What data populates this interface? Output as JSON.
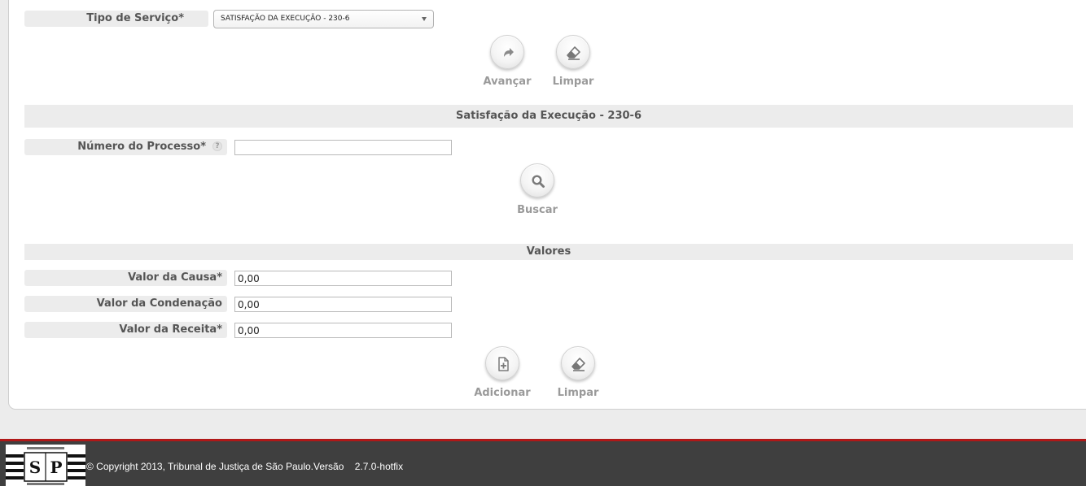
{
  "form": {
    "service_type": {
      "label": "Tipo de Serviço*",
      "selected": "SATISFAÇÃO DA EXECUÇÃO - 230-6"
    },
    "top_actions": {
      "advance_label": "Avançar",
      "clear_label": "Limpar"
    }
  },
  "section_process": {
    "title": "Satisfação da Execução - 230-6",
    "process_number_label": "Número do Processo*",
    "help_icon": "?",
    "process_number_value": "",
    "search_label": "Buscar"
  },
  "section_values": {
    "title": "Valores",
    "cause_value_label": "Valor da Causa*",
    "cause_value": "0,00",
    "condemnation_value_label": "Valor da Condenação",
    "condemnation_value": "0,00",
    "revenue_value_label": "Valor da Receita*",
    "revenue_value": "0,00",
    "add_label": "Adicionar",
    "clear_label": "Limpar"
  },
  "footer": {
    "copyright": "© Copyright 2013, Tribunal de Justiça de São Paulo.Versão    2.7.0-hotfix",
    "logo_letters": [
      "S",
      "P"
    ]
  },
  "colors": {
    "footer_bg": "#3f3f3f",
    "footer_accent": "#b01818",
    "label_bg": "#ececec"
  }
}
